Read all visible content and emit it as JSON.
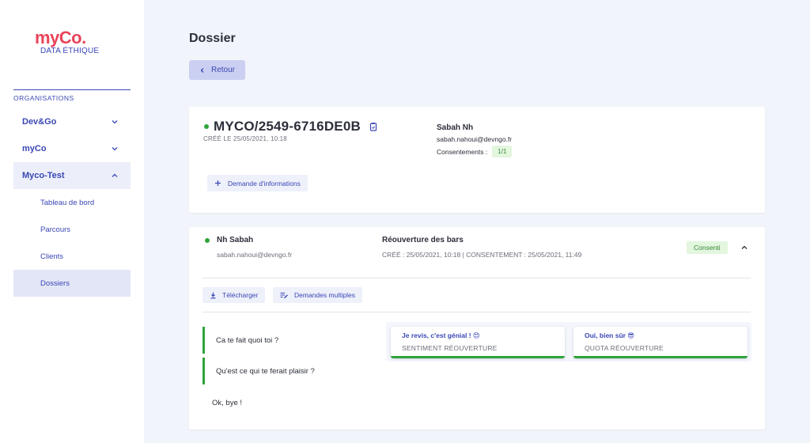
{
  "logo": {
    "main_prefix": "my",
    "main_suffix": "Co.",
    "sub": "DATA ÉTHIQUE"
  },
  "sidebar": {
    "section_label": "ORGANISATIONS",
    "orgs": [
      {
        "label": "Dev&Go"
      },
      {
        "label": "myCo"
      },
      {
        "label": "Myco-Test"
      }
    ],
    "sub_items": [
      {
        "label": "Tableau de bord"
      },
      {
        "label": "Parcours"
      },
      {
        "label": "Clients"
      },
      {
        "label": "Dossiers"
      }
    ]
  },
  "page": {
    "title": "Dossier",
    "back_label": "Retour"
  },
  "dossier": {
    "id": "MYCO/2549-6716DE0B",
    "created": "CRÉÉ LE 25/05/2021, 10:18",
    "client_name": "Sabah Nh",
    "client_email": "sabah.nahoui@devngo.fr",
    "consent_label": "Consentements :",
    "consent_value": "1/1",
    "request_button": "Demande d'informations"
  },
  "entry": {
    "person_name": "Nh Sabah",
    "person_email": "sabah.nahoui@devngo.fr",
    "parcours_name": "Réouverture des bars",
    "parcours_dates": "CRÉÉ : 25/05/2021, 10:18 | CONSENTEMENT : 25/05/2021, 11:49",
    "status": "Consenti",
    "download_button": "Télécharger",
    "multi_button": "Demandes multiples",
    "questions": [
      "Ca te fait quoi toi ?",
      "Qu'est ce qui te ferait plaisir ?",
      "Ok, bye !"
    ],
    "answers": [
      {
        "value": "Je revis, c'est génial ! 😍",
        "key": "SENTIMENT RÉOUVERTURE"
      },
      {
        "value": "Oui, bien sûr 😎",
        "key": "QUOTA RÉOUVERTURE"
      }
    ]
  },
  "colors": {
    "primary": "#3a47b5",
    "accent": "#e8445a",
    "success": "#2fa33a",
    "background": "#f2f4fb"
  }
}
